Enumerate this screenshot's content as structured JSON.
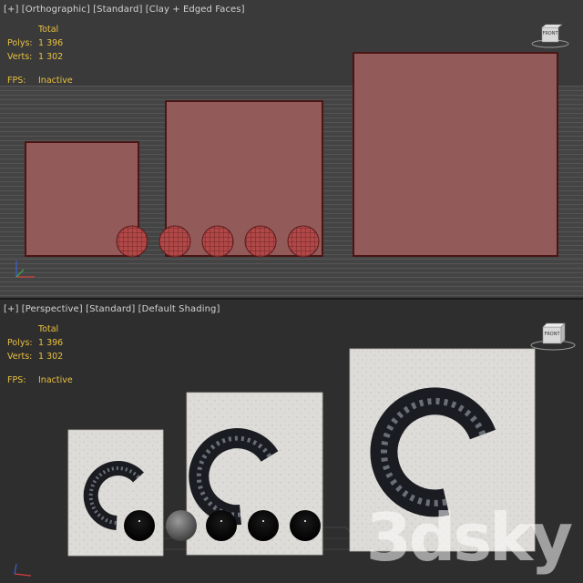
{
  "viewport_top": {
    "label_plus": "[+]",
    "label_view": "[Orthographic]",
    "label_shading": "[Standard]",
    "label_mode": "[Clay + Edged Faces]",
    "stats": {
      "total_label": "Total",
      "polys_label": "Polys:",
      "polys_value": "1 396",
      "verts_label": "Verts:",
      "verts_value": "1 302",
      "fps_label": "FPS:",
      "fps_value": "Inactive"
    },
    "viewcube_face": "FRONT"
  },
  "viewport_bottom": {
    "label_plus": "[+]",
    "label_view": "[Perspective]",
    "label_shading": "[Standard]",
    "label_mode": "[Default Shading]",
    "stats": {
      "total_label": "Total",
      "polys_label": "Polys:",
      "polys_value": "1 396",
      "verts_label": "Verts:",
      "verts_value": "1 302",
      "fps_label": "FPS:",
      "fps_value": "Inactive"
    },
    "viewcube_face": "FRONT"
  },
  "watermark": "3dsky",
  "colors": {
    "clay": "#935a5a",
    "clay_edge": "#4a1515",
    "stats_text": "#e8c040",
    "label_text": "#d4d4d4"
  }
}
